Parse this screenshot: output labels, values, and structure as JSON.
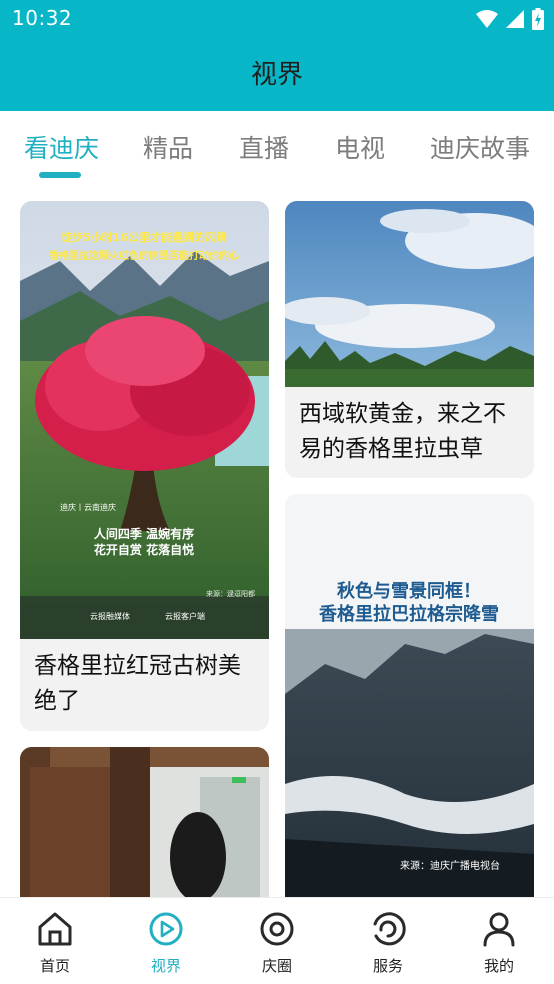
{
  "status_bar": {
    "time": "10:32",
    "icons": [
      "wifi-icon",
      "signal-icon",
      "battery-charging-icon"
    ]
  },
  "header": {
    "title": "视界",
    "background": "#08b7c7"
  },
  "tabs": [
    {
      "label": "看迪庆",
      "active": true
    },
    {
      "label": "精品",
      "active": false
    },
    {
      "label": "直播",
      "active": false
    },
    {
      "label": "电视",
      "active": false
    },
    {
      "label": "迪庆故事",
      "active": false
    }
  ],
  "accent_color": "#21afc2",
  "feed": {
    "cards": [
      {
        "caption": "香格里拉红冠古树美绝了",
        "image_text": {
          "headline_1": "徒步5小时16公里才能遇到的风景",
          "headline_2": "香格里拉这颗火红色的树是否能打动你的心",
          "location": "迪庆丨云南迪庆",
          "poem_1": "人间四季  温婉有序",
          "poem_2": "花开自赏  花落自悦",
          "source": "来源：逯逗阳都",
          "logo_1": "云报融媒体",
          "logo_2": "云报客户端"
        }
      },
      {
        "caption": "西域软黄金，来之不易的香格里拉虫草"
      },
      {
        "caption": "",
        "image_text": {
          "headline_1": "秋色与雪景同框！",
          "headline_2": "香格里拉巴拉格宗降雪",
          "source": "来源：迪庆广播电视台"
        }
      },
      {
        "caption": ""
      }
    ]
  },
  "bottom_nav": [
    {
      "label": "首页",
      "icon": "home-icon",
      "active": false
    },
    {
      "label": "视界",
      "icon": "play-circle-icon",
      "active": true
    },
    {
      "label": "庆圈",
      "icon": "target-circle-icon",
      "active": false
    },
    {
      "label": "服务",
      "icon": "refresh-circle-icon",
      "active": false
    },
    {
      "label": "我的",
      "icon": "person-icon",
      "active": false
    }
  ]
}
